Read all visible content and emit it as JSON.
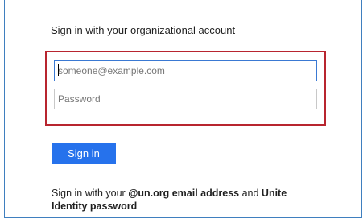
{
  "heading": "Sign in with your organizational account",
  "email": {
    "placeholder": "someone@example.com",
    "value": ""
  },
  "password": {
    "placeholder": "Password",
    "value": ""
  },
  "signin_button": "Sign in",
  "info": {
    "prefix": "Sign in with your ",
    "email_bold": "@un.org email address",
    "middle": " and ",
    "identity_bold": "Unite Identity password"
  },
  "colors": {
    "frame_border": "#3f7fbf",
    "highlight_border": "#b8252f",
    "button_bg": "#2672ec",
    "focus_border": "#3a79d3"
  }
}
